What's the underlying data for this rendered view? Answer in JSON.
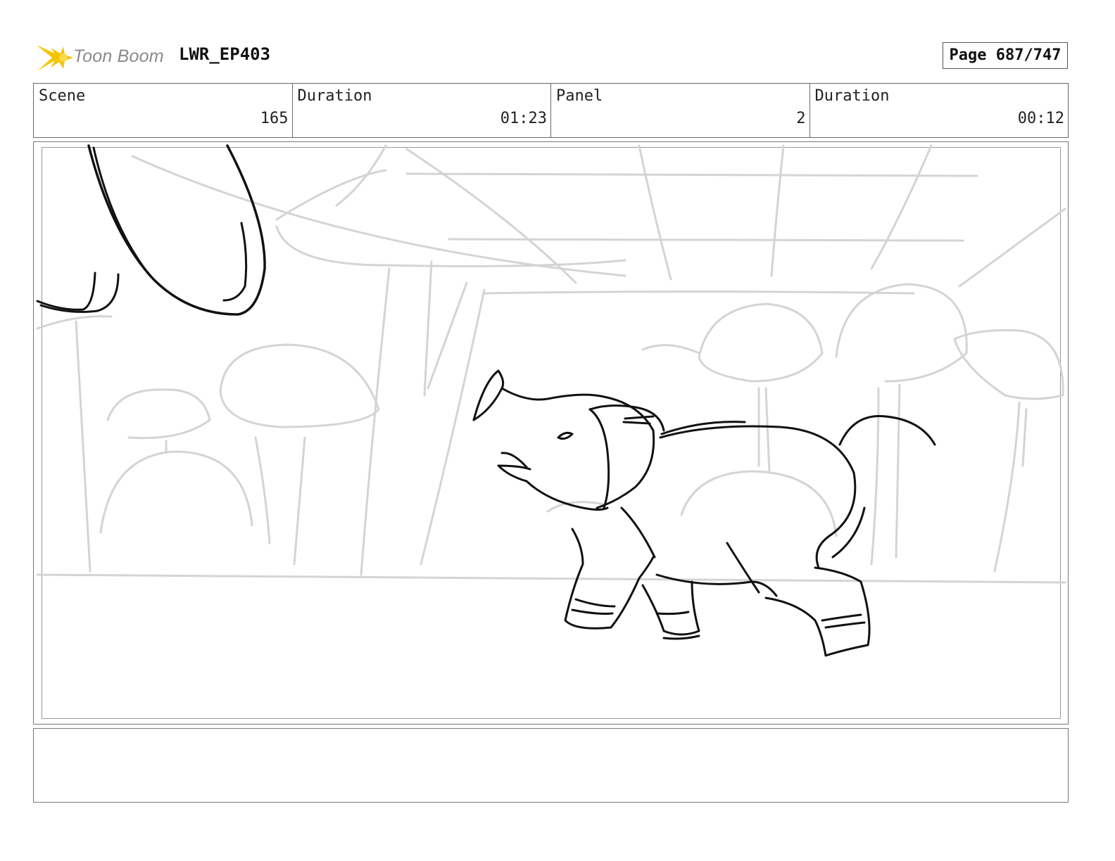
{
  "header": {
    "logo_text": "Toon Boom",
    "project_title": "LWR_EP403",
    "page_label": "Page 687/747"
  },
  "info_bar": {
    "scene_label": "Scene",
    "scene_value": "165",
    "scene_duration_label": "Duration",
    "scene_duration_value": "01:23",
    "panel_label": "Panel",
    "panel_value": "2",
    "panel_duration_label": "Duration",
    "panel_duration_value": "00:12"
  },
  "notes": {
    "text": ""
  },
  "colors": {
    "logo_accent": "#f5c400",
    "sketch_light": "#d4d4d4",
    "sketch_dark": "#111111"
  }
}
